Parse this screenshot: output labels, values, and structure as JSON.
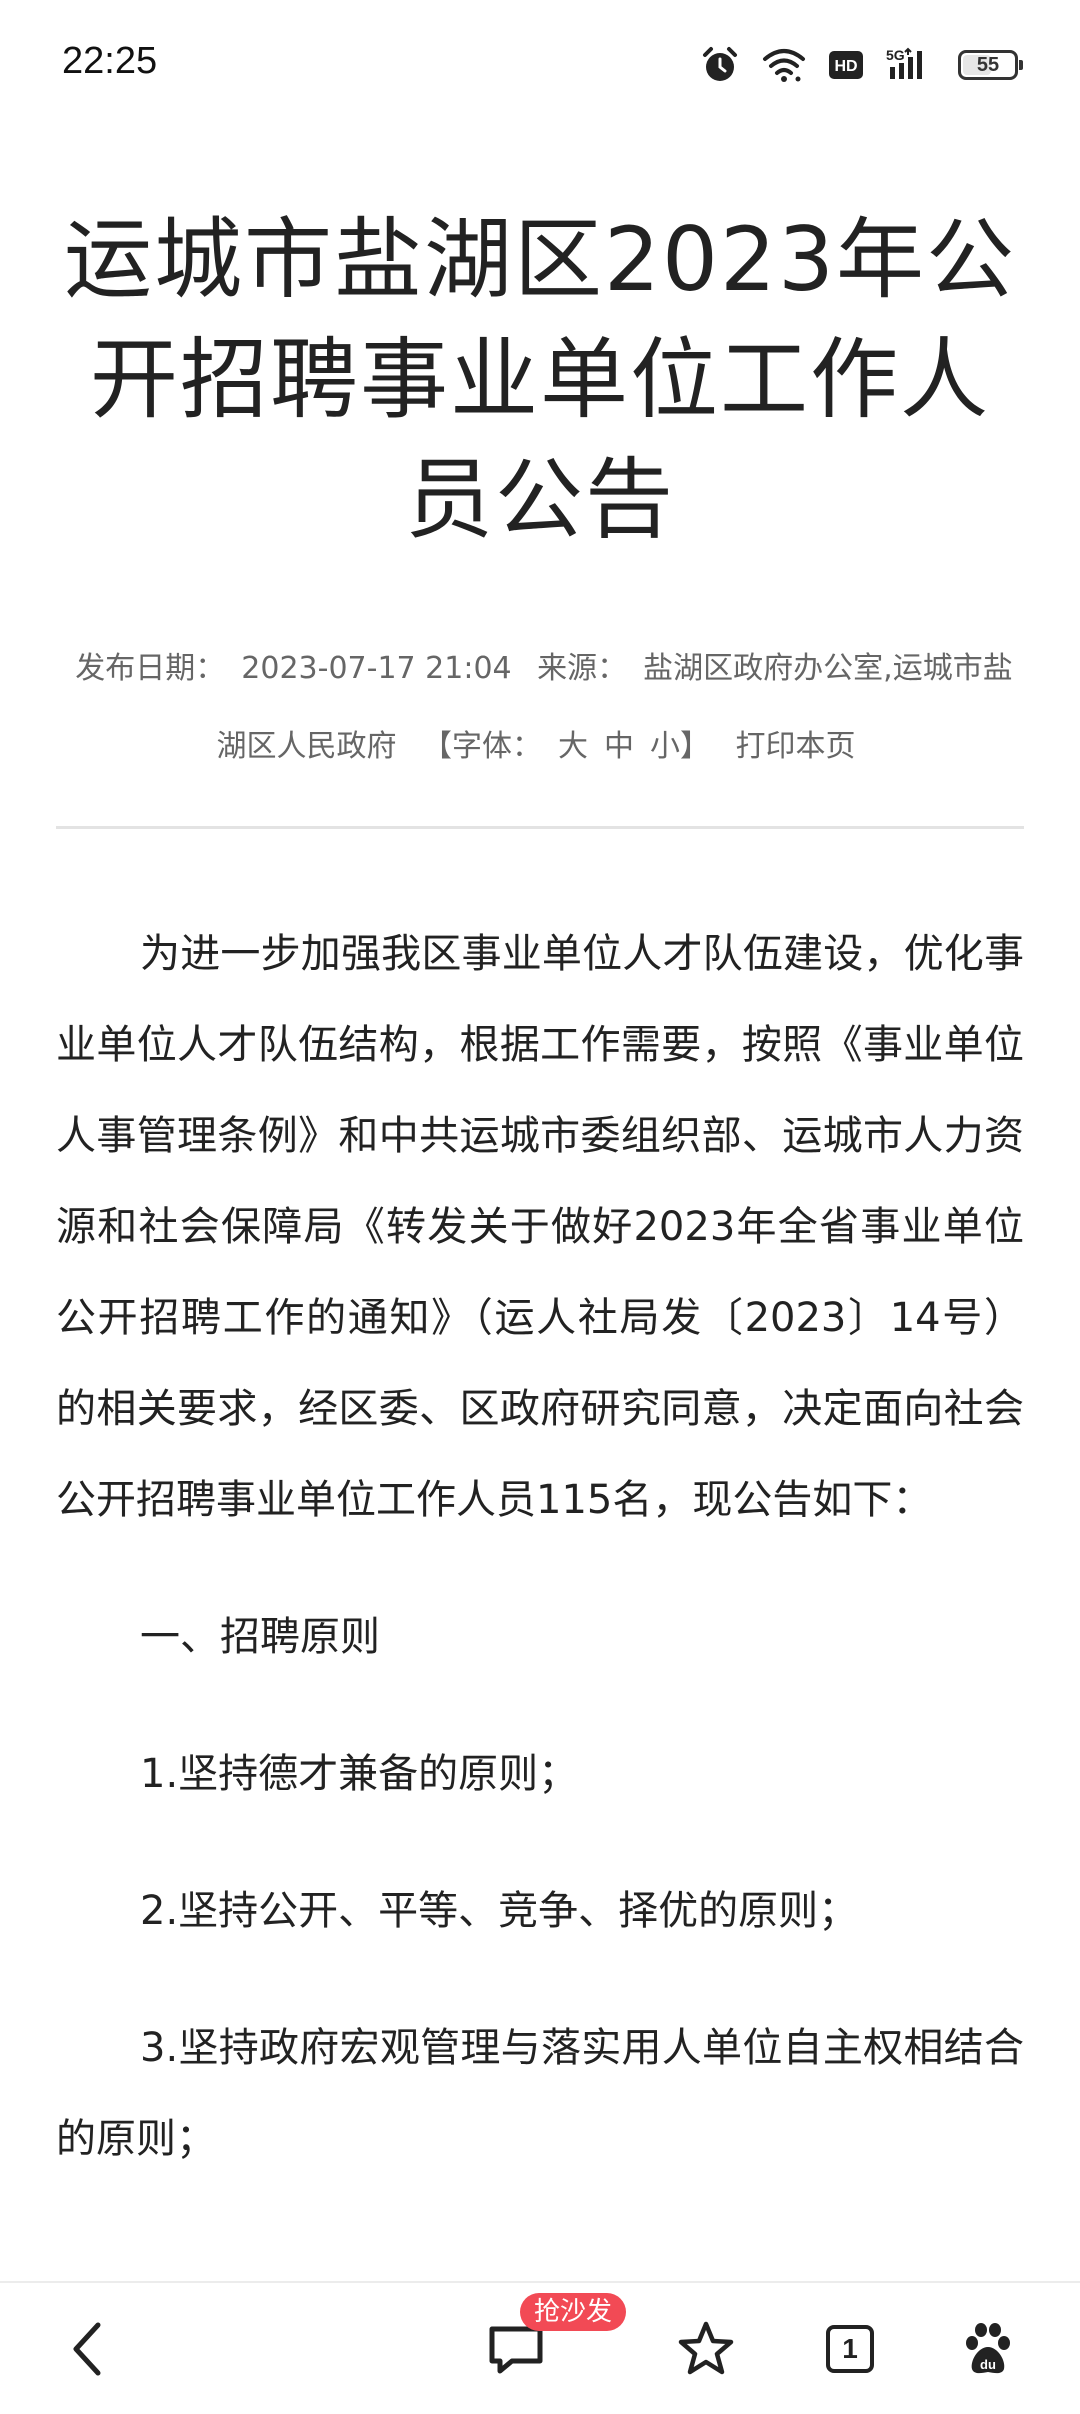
{
  "status_bar": {
    "time": "22:25",
    "battery": "55",
    "icons": [
      "alarm-icon",
      "wifi-icon",
      "hd-icon",
      "5g-signal-icon",
      "battery-icon"
    ]
  },
  "article": {
    "title": "运城市盐湖区2023年公开招聘事业单位工作人员公告",
    "meta": {
      "date_label": "发布日期：",
      "date": "2023-07-17 21:04",
      "source_label": "来源：",
      "source": "盐湖区政府办公室,运城市盐湖区人民政府",
      "font_label": "【字体：",
      "font_large": "大",
      "font_medium": "中",
      "font_small": "小】",
      "print": "打印本页"
    },
    "paragraph": "为进一步加强我区事业单位人才队伍建设，优化事业单位人才队伍结构，根据工作需要，按照《事业单位人事管理条例》和中共运城市委组织部、运城市人力资源和社会保障局《转发关于做好2023年全省事业单位公开招聘工作的通知》（运人社局发〔2023〕14号）的相关要求，经区委、区政府研究同意，决定面向社会公开招聘事业单位工作人员115名，现公告如下：",
    "section1": "一、招聘原则",
    "item1": "1.坚持德才兼备的原则；",
    "item2": "2.坚持公开、平等、竞争、择优的原则；",
    "item3": "3.坚持政府宏观管理与落实用人单位自主权相结合的原则；"
  },
  "bottom_bar": {
    "badge": "抢沙发",
    "tab_count": "1",
    "icons": [
      "back-icon",
      "comment-icon",
      "star-icon",
      "tabs-icon",
      "baidu-paw-icon"
    ]
  }
}
